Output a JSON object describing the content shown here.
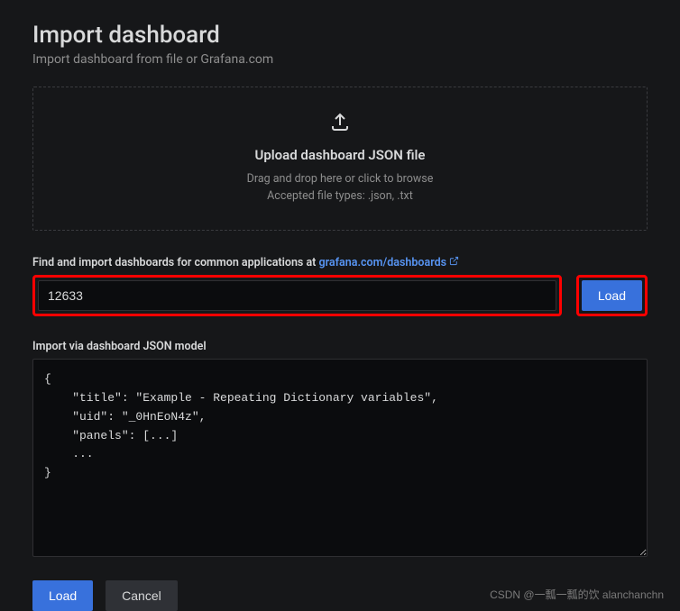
{
  "page": {
    "title": "Import dashboard",
    "subtitle": "Import dashboard from file or Grafana.com"
  },
  "upload": {
    "title": "Upload dashboard JSON file",
    "hint1": "Drag and drop here or click to browse",
    "hint2": "Accepted file types: .json, .txt"
  },
  "urlField": {
    "labelPrefix": "Find and import dashboards for common applications at ",
    "linkText": "grafana.com/dashboards",
    "value": "12633",
    "loadLabel": "Load"
  },
  "jsonField": {
    "label": "Import via dashboard JSON model",
    "value": "{\n    \"title\": \"Example - Repeating Dictionary variables\",\n    \"uid\": \"_0HnEoN4z\",\n    \"panels\": [...]\n    ...\n}"
  },
  "actions": {
    "load": "Load",
    "cancel": "Cancel"
  },
  "watermark": "CSDN @一瓢一瓢的饮 alanchanchn"
}
